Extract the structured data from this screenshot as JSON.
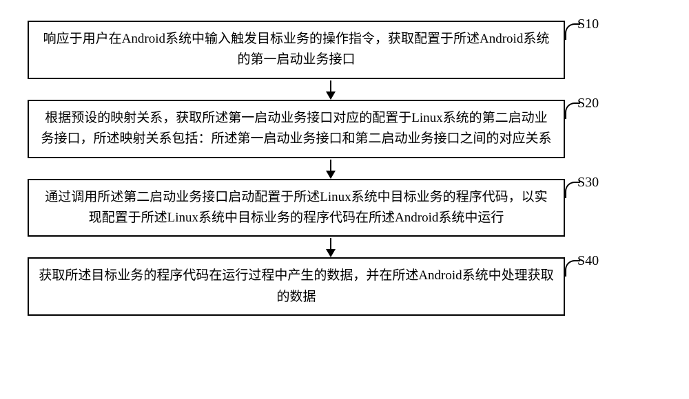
{
  "steps": [
    {
      "label": "S10",
      "text": "响应于用户在Android系统中输入触发目标业务的操作指令，获取配置于所述Android系统的第一启动业务接口"
    },
    {
      "label": "S20",
      "text": "根据预设的映射关系，获取所述第一启动业务接口对应的配置于Linux系统的第二启动业务接口，所述映射关系包括：所述第一启动业务接口和第二启动业务接口之间的对应关系"
    },
    {
      "label": "S30",
      "text": "通过调用所述第二启动业务接口启动配置于所述Linux系统中目标业务的程序代码，以实现配置于所述Linux系统中目标业务的程序代码在所述Android系统中运行"
    },
    {
      "label": "S40",
      "text": "获取所述目标业务的程序代码在运行过程中产生的数据，并在所述Android系统中处理获取的数据"
    }
  ]
}
